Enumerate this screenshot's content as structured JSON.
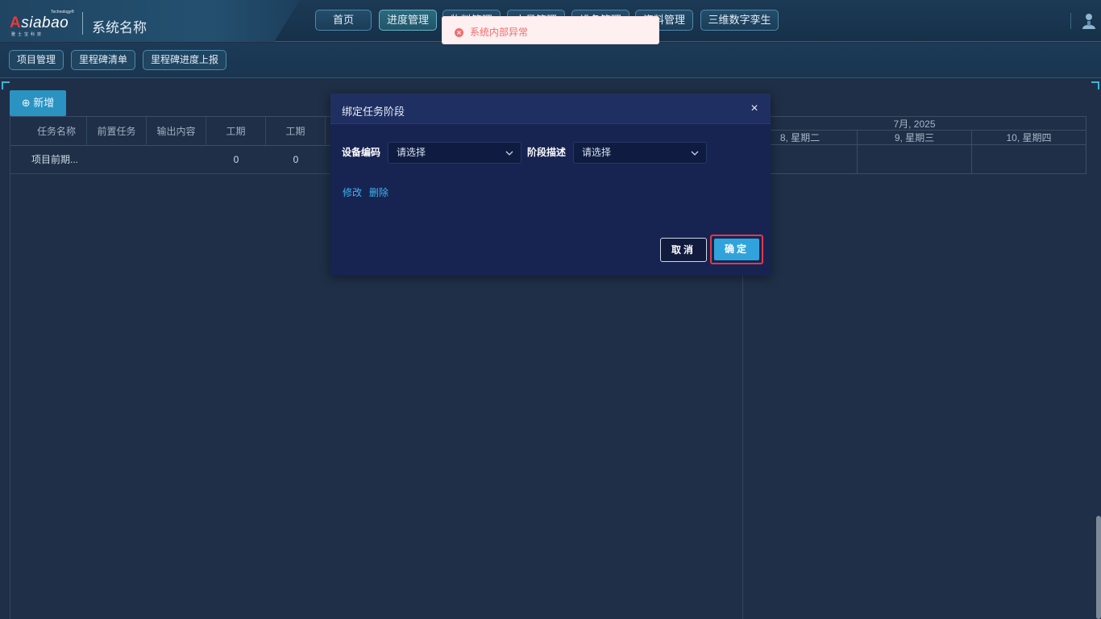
{
  "brand": {
    "logo_tech": "Technology®",
    "logo_main": "siabao",
    "logo_a": "A",
    "logo_sub": "雅士宝科技",
    "system_name": "系统名称"
  },
  "nav": {
    "items": [
      {
        "label": "首页"
      },
      {
        "label": "进度管理"
      },
      {
        "label": "物料管理"
      },
      {
        "label": "人员管理"
      },
      {
        "label": "设备管理"
      },
      {
        "label": "资料管理"
      },
      {
        "label": "三维数字孪生"
      }
    ],
    "active_index": 1
  },
  "subnav": {
    "items": [
      {
        "label": "项目管理"
      },
      {
        "label": "里程碑清单"
      },
      {
        "label": "里程碑进度上报"
      }
    ]
  },
  "toolbar": {
    "add_label": "⊕ 新增"
  },
  "grid": {
    "columns": [
      "任务名称",
      "前置任务",
      "输出内容",
      "工期",
      "工期"
    ],
    "rows": [
      {
        "name": "项目前期...",
        "pre": "",
        "output": "",
        "d1": "0",
        "d2": "0"
      }
    ]
  },
  "gantt": {
    "month": "7月, 2025",
    "days": [
      "8, 星期二",
      "9, 星期三",
      "10, 星期四"
    ]
  },
  "modal": {
    "title": "绑定任务阶段",
    "close": "×",
    "device_label": "设备编码",
    "device_placeholder": "请选择",
    "stage_label": "阶段描述",
    "stage_placeholder": "请选择",
    "edit_link": "修改",
    "delete_link": "删除",
    "cancel_label": "取消",
    "ok_label": "确定"
  },
  "toast": {
    "message": "系统内部异常",
    "type": "error",
    "color": "#f56c6c"
  },
  "colors": {
    "accent": "#31a3dc",
    "toast_bg": "#fef0f0",
    "highlight_border": "#e03a46"
  }
}
